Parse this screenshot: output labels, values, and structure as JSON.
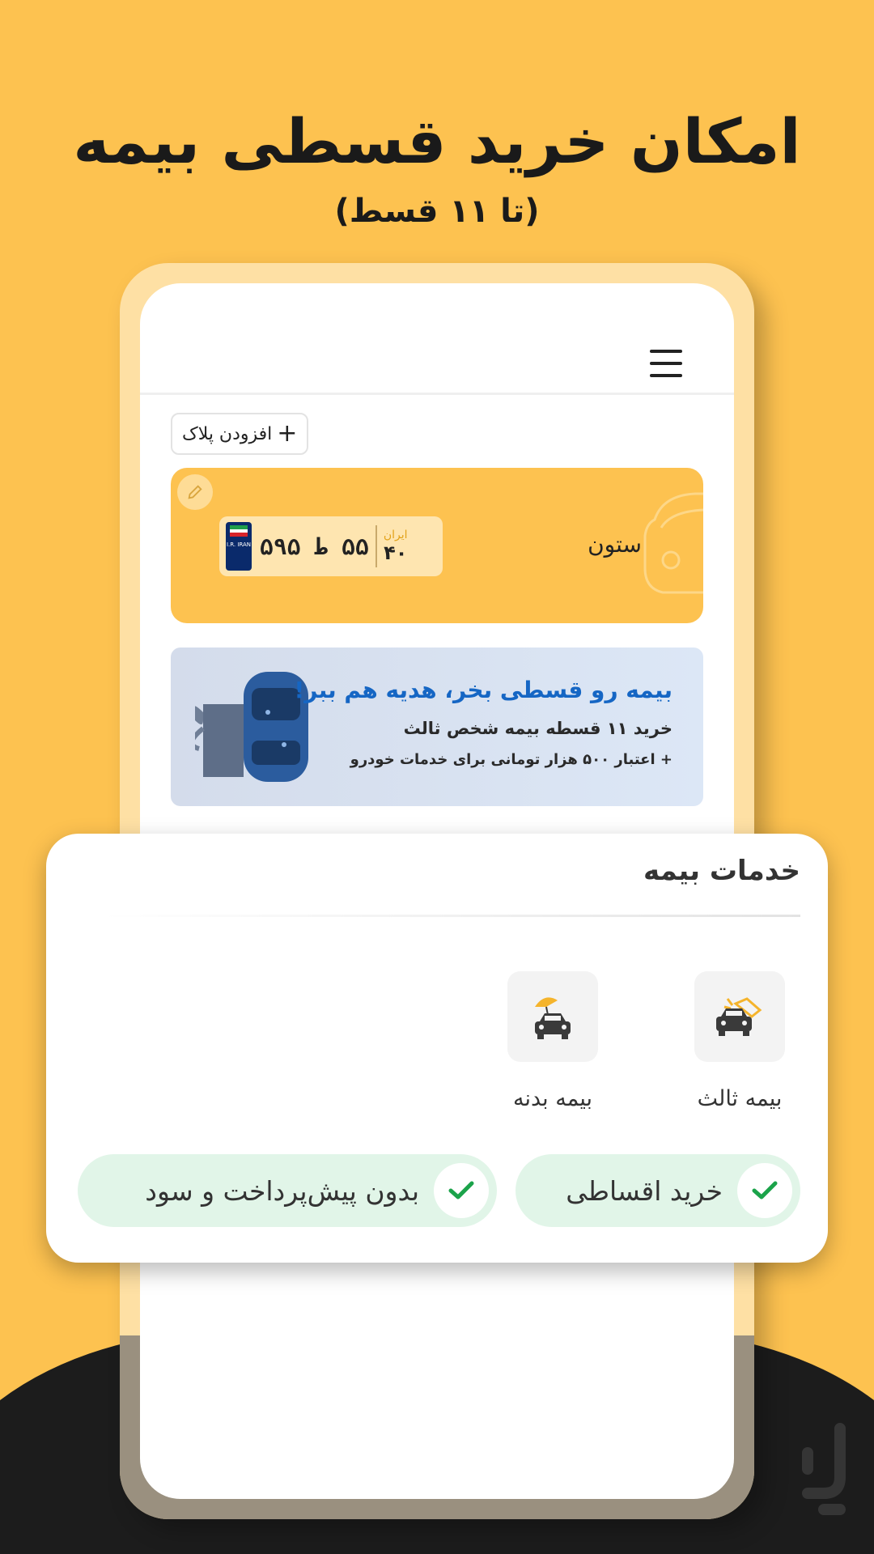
{
  "header": {
    "headline": "امکان خرید قسطی بیمه",
    "subheadline": "(تا ۱۱ قسط)"
  },
  "app": {
    "menu_icon": "hamburger-menu-icon",
    "add_plate_label": "افزودن پلاک",
    "vehicle": {
      "name": "ستون",
      "plate_number": "۵۵ ط ۵۹۵",
      "plate_region_word": "ایران",
      "plate_region_code": "۴۰",
      "plate_flag_text": "I.R. IRAN"
    },
    "banner": {
      "title": "بیمه رو قسطی بخر، هدیه هم ببر!",
      "line2": "خرید ۱۱ قسطه بیمه شخص ثالث",
      "line3": "+ اعتبار ۵۰۰ هزار تومانی برای خدمات خودرو"
    }
  },
  "services": {
    "title": "خدمات بیمه",
    "items": [
      {
        "label": "بیمه ثالث",
        "icon": "car-crash-icon"
      },
      {
        "label": "بیمه بدنه",
        "icon": "car-umbrella-icon"
      }
    ],
    "features": [
      {
        "label": "خرید اقساطی",
        "icon": "check-icon"
      },
      {
        "label": "بدون پیش‌پرداخت و سود",
        "icon": "check-icon"
      }
    ]
  },
  "colors": {
    "background": "#FDC250",
    "accent_green": "#1BA34A",
    "pill_bg": "#E1F5E8",
    "banner_title": "#1566C4"
  }
}
